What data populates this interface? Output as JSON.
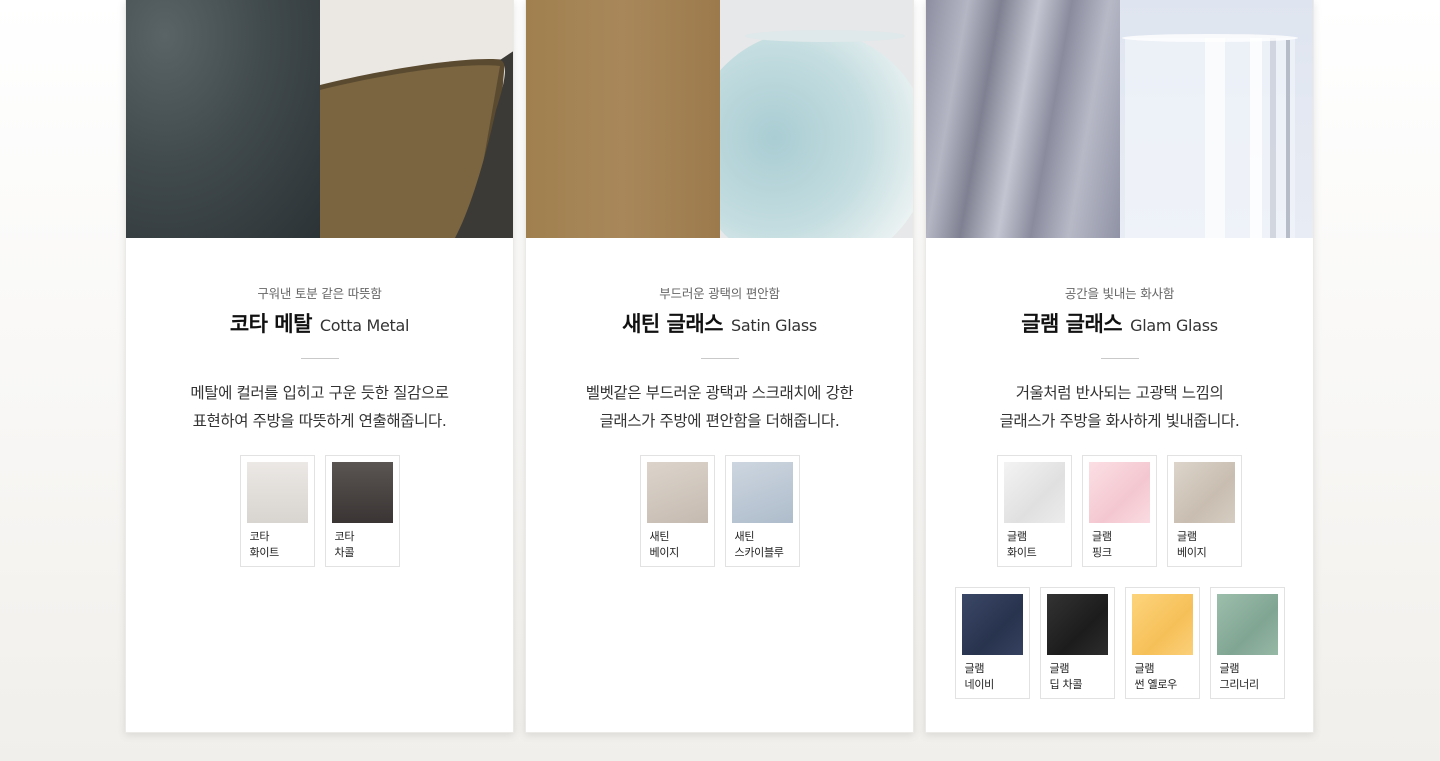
{
  "cards": [
    {
      "eyebrow": "구워낸 토분 같은 따뜻함",
      "title_ko": "코타 메탈",
      "title_en": "Cotta Metal",
      "desc_line1": "메탈에 컬러를 입히고 구운 듯한 질감으로",
      "desc_line2": "표현하여 주방을 따뜻하게 연출해줍니다.",
      "swatches": [
        {
          "line1": "코타",
          "line2": "화이트",
          "color": "#e3dfdb"
        },
        {
          "line1": "코타",
          "line2": "차콜",
          "color": "#4a4544"
        }
      ]
    },
    {
      "eyebrow": "부드러운 광택의 편안함",
      "title_ko": "새틴 글래스",
      "title_en": "Satin Glass",
      "desc_line1": "벨벳같은 부드러운 광택과 스크래치에 강한",
      "desc_line2": "글래스가 주방에 편안함을 더해줍니다.",
      "swatches": [
        {
          "line1": "새틴",
          "line2": "베이지",
          "color": "#d4cbc2"
        },
        {
          "line1": "새틴",
          "line2": "스카이블루",
          "color": "#c0ccd8"
        }
      ]
    },
    {
      "eyebrow": "공간을 빛내는 화사함",
      "title_ko": "글램 글래스",
      "title_en": "Glam Glass",
      "desc_line1": "거울처럼 반사되는 고광택 느낌의",
      "desc_line2": "글래스가 주방을 화사하게 빛내줍니다.",
      "swatches": [
        {
          "line1": "글램",
          "line2": "화이트",
          "color": "#e9e9e9"
        },
        {
          "line1": "글램",
          "line2": "핑크",
          "color": "#f8d3da"
        },
        {
          "line1": "글램",
          "line2": "베이지",
          "color": "#d3c9bd"
        },
        {
          "line1": "글램",
          "line2": "네이비",
          "color": "#323e5c"
        },
        {
          "line1": "글램",
          "line2": "딥 차콜",
          "color": "#272727"
        },
        {
          "line1": "글램",
          "line2": "썬 옐로우",
          "color": "#fbcb6a"
        },
        {
          "line1": "글램",
          "line2": "그리너리",
          "color": "#8fb3a0"
        }
      ]
    }
  ]
}
